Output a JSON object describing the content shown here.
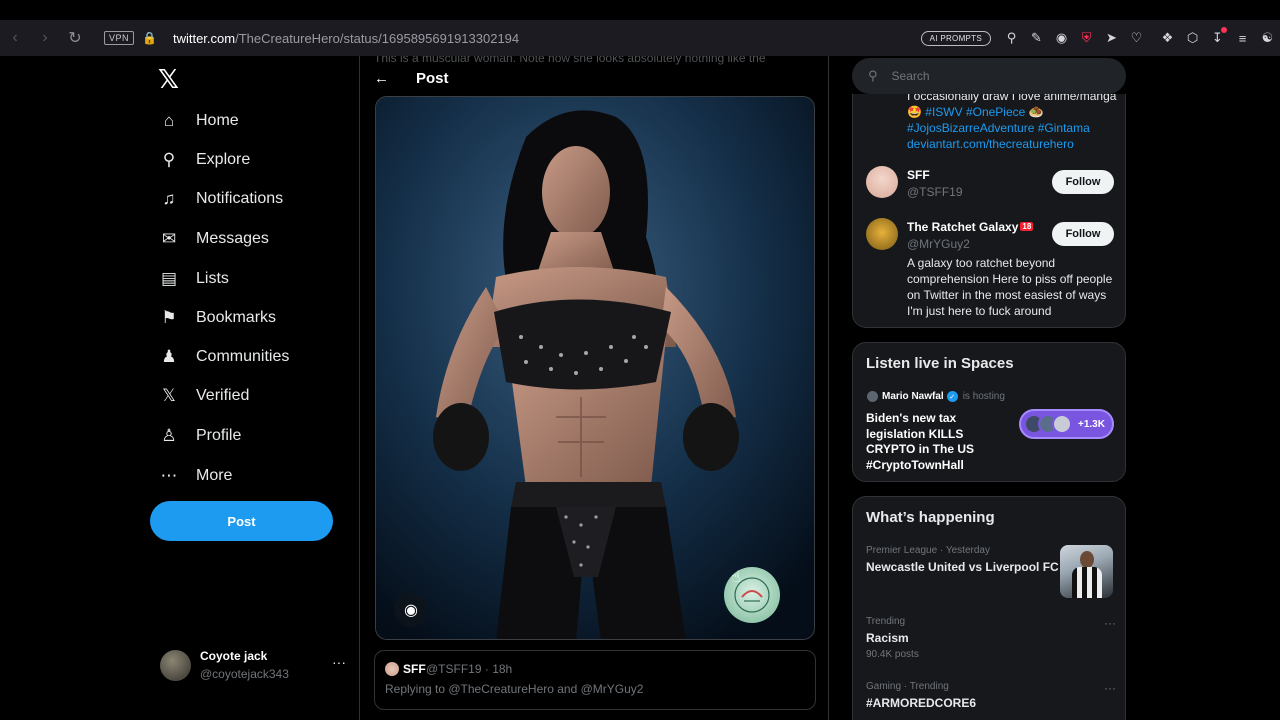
{
  "browser": {
    "vpn_label": "VPN",
    "url_host": "twitter.com",
    "url_path": "/TheCreatureHero/status/1695895691913302194",
    "ai_prompts_label": "AI PROMPTS"
  },
  "nav": {
    "items": [
      {
        "label": "Home",
        "icon": "home-icon"
      },
      {
        "label": "Explore",
        "icon": "search-icon"
      },
      {
        "label": "Notifications",
        "icon": "bell-icon"
      },
      {
        "label": "Messages",
        "icon": "envelope-icon"
      },
      {
        "label": "Lists",
        "icon": "list-icon"
      },
      {
        "label": "Bookmarks",
        "icon": "bookmark-icon"
      },
      {
        "label": "Communities",
        "icon": "people-icon"
      },
      {
        "label": "Verified",
        "icon": "x-logo-icon"
      },
      {
        "label": "Profile",
        "icon": "person-icon"
      },
      {
        "label": "More",
        "icon": "more-circle-icon"
      }
    ],
    "post_button": "Post"
  },
  "account": {
    "name": "Coyote jack",
    "handle": "@coyotejack343"
  },
  "main": {
    "ghost_text": "This is a muscular woman. Note how she looks absolutely nothing like the",
    "header_title": "Post",
    "reply": {
      "name": "SFF",
      "meta": "@TSFF19 · 18h",
      "replying_to": "Replying to @TheCreatureHero and @MrYGuy2"
    }
  },
  "right": {
    "search_placeholder": "Search",
    "top_bio": {
      "line1": "I occasionally draw I love anime/manga",
      "tags1": "🤩 #ISWV #OnePiece 🧆",
      "tags2": "#JojosBizarreAdventure #Gintama",
      "link": "deviantart.com/thecreaturehero"
    },
    "who_to_follow": [
      {
        "name": "SFF",
        "handle": "@TSFF19",
        "follow": "Follow"
      },
      {
        "name": "The Ratchet Galaxy",
        "badge": "18",
        "handle": "@MrYGuy2",
        "follow": "Follow",
        "bio": "A galaxy too ratchet beyond comprehension Here to piss off people on Twitter in the most easiest of ways I'm just here to fuck around"
      }
    ],
    "spaces": {
      "title": "Listen live in Spaces",
      "host": "Mario Nawfal",
      "status": "is hosting",
      "space_title": "Biden's new tax legislation KILLS CRYPTO in The US #CryptoTownHall",
      "listeners": "+1.3K"
    },
    "happening": {
      "title": "What’s happening",
      "trends": [
        {
          "meta": "Premier League · Yesterday",
          "title": "Newcastle United vs Liverpool FC",
          "count": ""
        },
        {
          "meta": "Trending",
          "title": "Racism",
          "count": "90.4K posts"
        },
        {
          "meta": "Gaming · Trending",
          "title": "#ARMOREDCORE6",
          "count": ""
        }
      ]
    }
  }
}
